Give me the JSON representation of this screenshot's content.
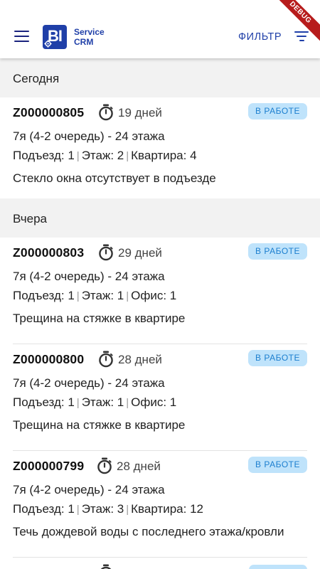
{
  "header": {
    "brand_line1": "Service",
    "brand_line2": "CRM",
    "logo_text": "BI",
    "filter_label": "ФИЛЬТР",
    "debug_label": "DEBUG"
  },
  "sections": [
    {
      "title": "Сегодня",
      "tickets": [
        {
          "id": "Z000000805",
          "days": "19 дней",
          "status": "В РАБОТЕ",
          "project": "7я (4-2 очередь) - 24 этажа",
          "loc": [
            "Подъезд: 1",
            "Этаж: 2",
            "Квартира: 4"
          ],
          "description": "Стекло окна отсутствует в подъезде"
        }
      ]
    },
    {
      "title": "Вчера",
      "tickets": [
        {
          "id": "Z000000803",
          "days": "29 дней",
          "status": "В РАБОТЕ",
          "project": "7я (4-2 очередь) - 24 этажа",
          "loc": [
            "Подъезд: 1",
            "Этаж: 1",
            "Офис: 1"
          ],
          "description": "Трещина на стяжке в квартире"
        },
        {
          "id": "Z000000800",
          "days": "28 дней",
          "status": "В РАБОТЕ",
          "project": "7я (4-2 очередь) - 24 этажа",
          "loc": [
            "Подъезд: 1",
            "Этаж: 1",
            "Офис: 1"
          ],
          "description": "Трещина на стяжке в квартире"
        },
        {
          "id": "Z000000799",
          "days": "28 дней",
          "status": "В РАБОТЕ",
          "project": "7я (4-2 очередь) - 24 этажа",
          "loc": [
            "Подъезд: 1",
            "Этаж: 3",
            "Квартира: 12"
          ],
          "description": "Течь дождевой воды с последнего этажа/кровли"
        }
      ]
    }
  ],
  "colors": {
    "brand": "#1f3fa8",
    "status_bg": "#bfe3fb",
    "status_text": "#1c7fcf",
    "section_bg": "#f2f2f2",
    "debug": "#b71c1c"
  },
  "icons": [
    "menu-icon",
    "gear-icon",
    "filter-icon",
    "timer-icon"
  ]
}
